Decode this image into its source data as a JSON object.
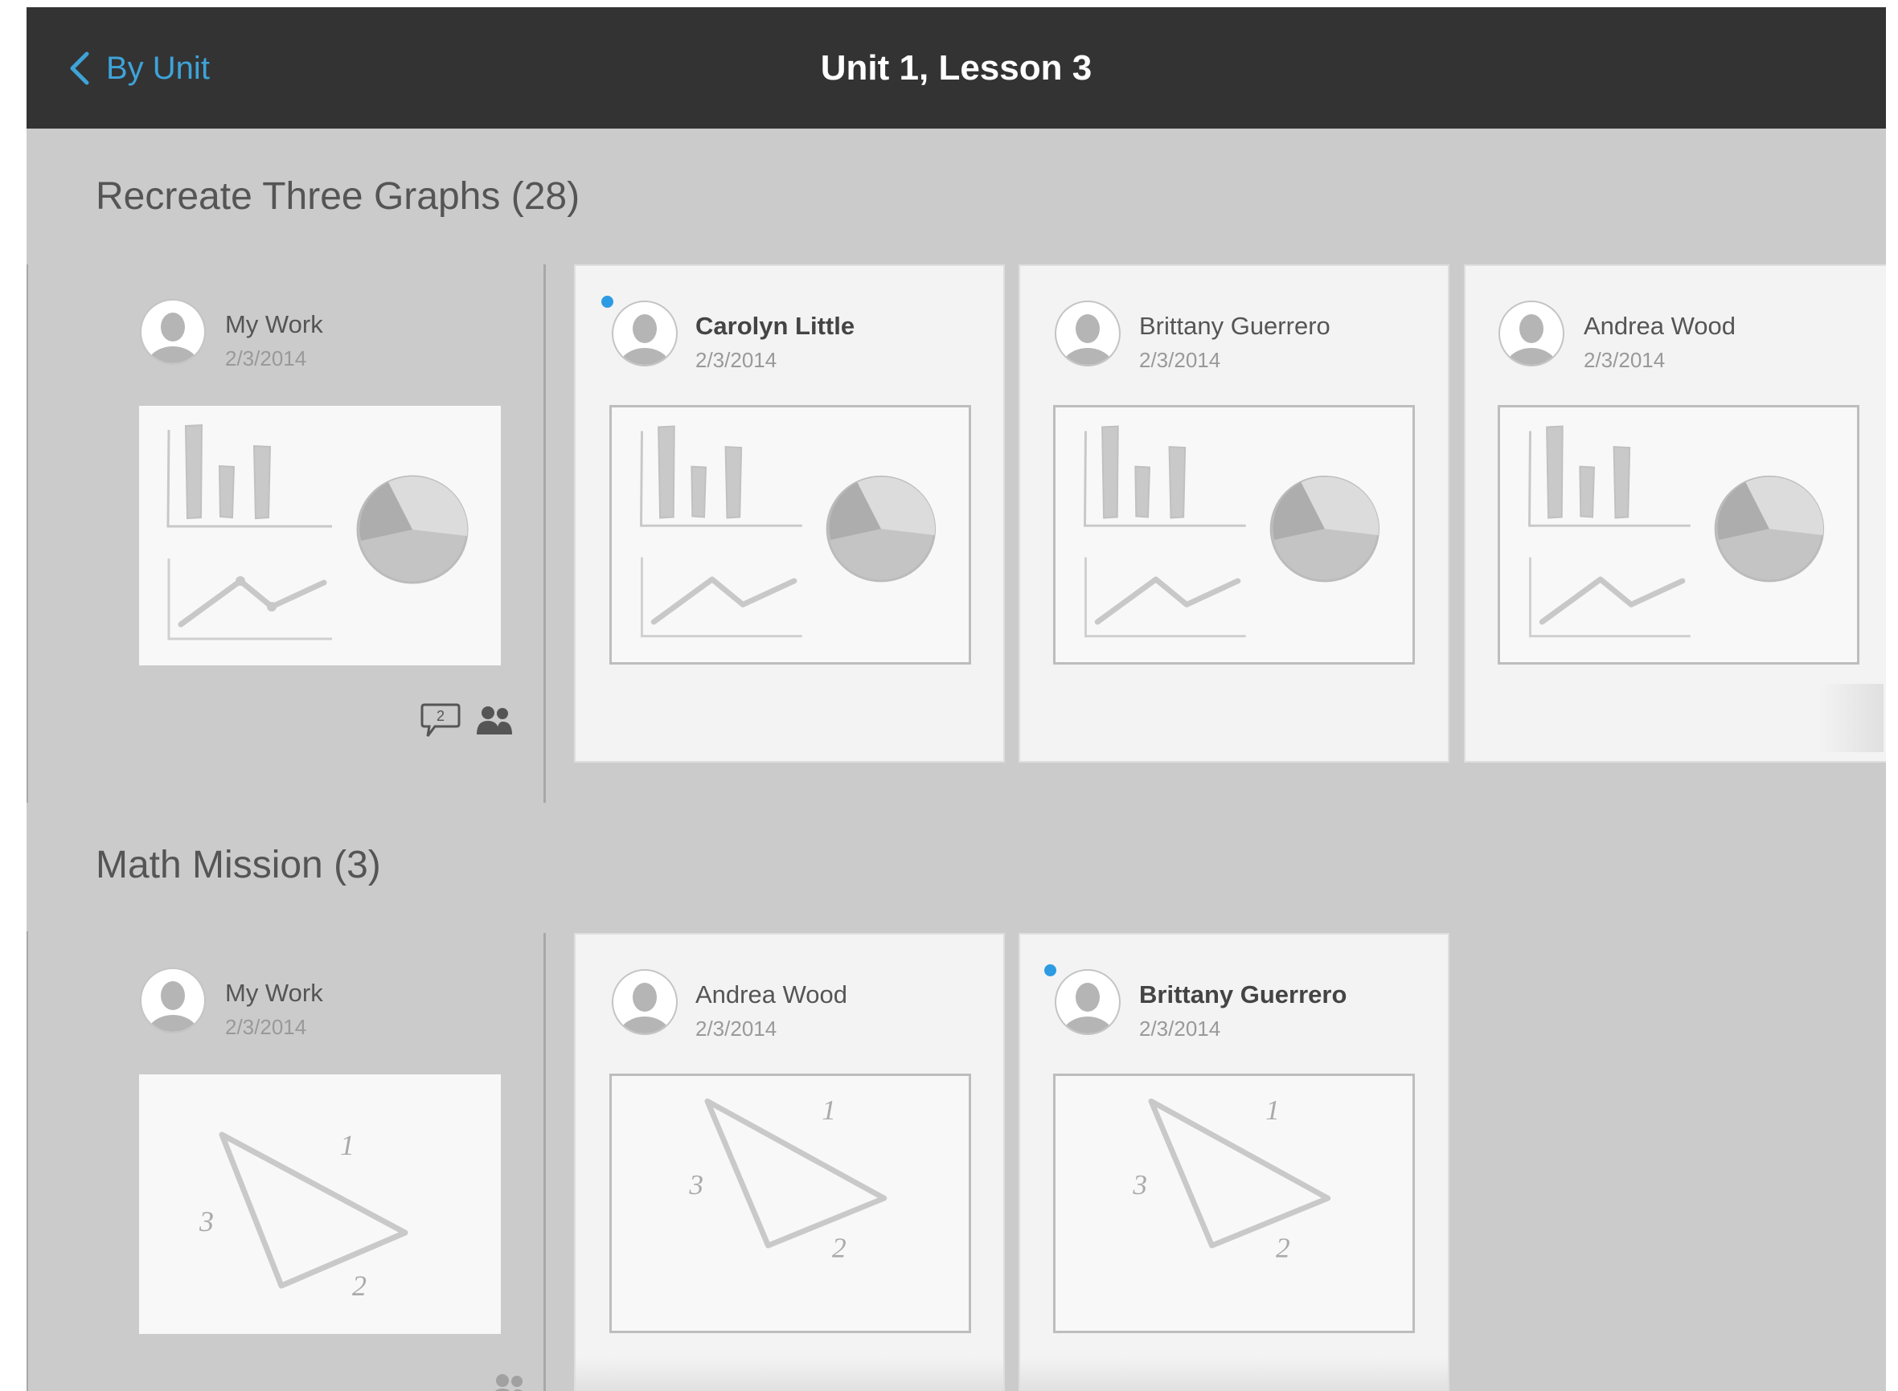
{
  "nav": {
    "back_label": "By Unit",
    "title": "Unit 1, Lesson 3"
  },
  "sections": [
    {
      "title": "Recreate Three Graphs  (28)",
      "my_work": {
        "name": "My Work",
        "date": "2/3/2014",
        "comment_count": "2"
      },
      "cards": [
        {
          "name": "Carolyn Little",
          "date": "2/3/2014",
          "unread": true
        },
        {
          "name": "Brittany Guerrero",
          "date": "2/3/2014",
          "unread": false
        },
        {
          "name": "Andrea Wood",
          "date": "2/3/2014",
          "unread": false
        }
      ]
    },
    {
      "title": "Math Mission (3)",
      "my_work": {
        "name": "My Work",
        "date": "2/3/2014"
      },
      "cards": [
        {
          "name": "Andrea Wood",
          "date": "2/3/2014",
          "unread": false
        },
        {
          "name": "Brittany Guerrero",
          "date": "2/3/2014",
          "unread": true
        }
      ]
    }
  ],
  "triangle_labels": [
    "1",
    "2",
    "3"
  ],
  "colors": {
    "navbar": "#333333",
    "accent": "#3ea3d8",
    "unread_dot": "#2d9be3",
    "background": "#cbcbcb"
  },
  "icons": {
    "back": "chevron-left-icon",
    "avatar": "avatar-icon",
    "comment": "comment-icon",
    "group": "group-icon"
  }
}
